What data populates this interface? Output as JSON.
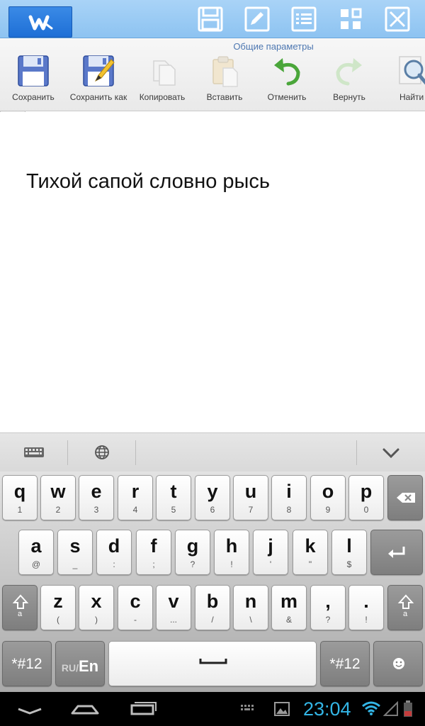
{
  "ribbon": {
    "title": "Общие параметры",
    "buttons": [
      {
        "label": "Сохранить"
      },
      {
        "label": "Сохранить как"
      },
      {
        "label": "Копировать"
      },
      {
        "label": "Вставить"
      },
      {
        "label": "Отменить"
      },
      {
        "label": "Вернуть"
      },
      {
        "label": "Найти"
      }
    ]
  },
  "document": {
    "text": "Тихой сапой словно рысь"
  },
  "keyboard": {
    "row1": [
      {
        "main": "q",
        "sub": "1"
      },
      {
        "main": "w",
        "sub": "2"
      },
      {
        "main": "e",
        "sub": "3"
      },
      {
        "main": "r",
        "sub": "4"
      },
      {
        "main": "t",
        "sub": "5"
      },
      {
        "main": "y",
        "sub": "6"
      },
      {
        "main": "u",
        "sub": "7"
      },
      {
        "main": "i",
        "sub": "8"
      },
      {
        "main": "o",
        "sub": "9"
      },
      {
        "main": "p",
        "sub": "0"
      }
    ],
    "row2": [
      {
        "main": "a",
        "sub": "@"
      },
      {
        "main": "s",
        "sub": "_"
      },
      {
        "main": "d",
        "sub": ":"
      },
      {
        "main": "f",
        "sub": ";"
      },
      {
        "main": "g",
        "sub": "?"
      },
      {
        "main": "h",
        "sub": "!"
      },
      {
        "main": "j",
        "sub": "'"
      },
      {
        "main": "k",
        "sub": "\""
      },
      {
        "main": "l",
        "sub": "$"
      }
    ],
    "row3": [
      {
        "main": "z",
        "sub": "("
      },
      {
        "main": "x",
        "sub": ")"
      },
      {
        "main": "c",
        "sub": "-"
      },
      {
        "main": "v",
        "sub": "..."
      },
      {
        "main": "b",
        "sub": "/"
      },
      {
        "main": "n",
        "sub": "\\"
      },
      {
        "main": "m",
        "sub": "&"
      },
      {
        "main": ",",
        "sub": "?"
      },
      {
        "main": ".",
        "sub": "!"
      }
    ],
    "symbols_label": "*#12",
    "lang_switch_prefix": "RU/",
    "lang_switch_main": "En",
    "shift_sub": "a"
  },
  "status": {
    "time": "23:04"
  }
}
